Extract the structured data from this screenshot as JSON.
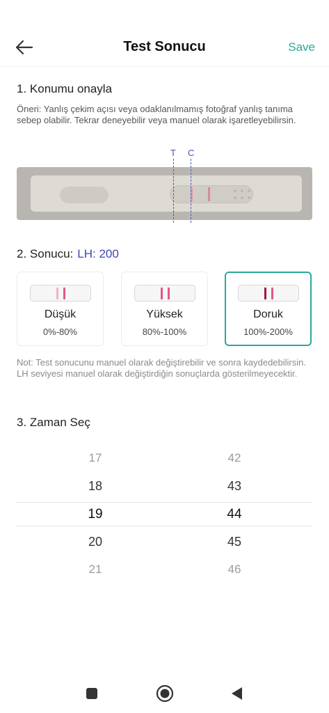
{
  "header": {
    "title": "Test Sonucu",
    "save_label": "Save",
    "back_icon": "arrow-left-icon"
  },
  "section1": {
    "title": "1. Konumu onayla",
    "description": "Öneri: Yanlış çekim açısı veya odaklanılmamış fotoğraf yanlış tanıma sebep olabilir. Tekrar deneyebilir veya manuel olarak işaretleyebilirsin.",
    "marker_t": "T",
    "marker_c": "C"
  },
  "section2": {
    "title": "2. Sonucu:",
    "lh_value": "LH: 200",
    "cards": [
      {
        "label": "Düşük",
        "range": "0%-80%",
        "selected": false
      },
      {
        "label": "Yüksek",
        "range": "80%-100%",
        "selected": false
      },
      {
        "label": "Doruk",
        "range": "100%-200%",
        "selected": true
      }
    ],
    "note": "Not: Test sonucunu manuel olarak değiştirebilir ve sonra kaydedebilirsin. LH seviyesi manuel olarak değiştirdiğin sonuçlarda gösterilmeyecektir."
  },
  "section3": {
    "title": "3. Zaman Seç",
    "hours": [
      "17",
      "18",
      "19",
      "20",
      "21"
    ],
    "minutes": [
      "42",
      "43",
      "44",
      "45",
      "46"
    ],
    "selected_hour": "19",
    "selected_minute": "44"
  },
  "colors": {
    "accent": "#2aa89a",
    "lh": "#3b46b0",
    "marker": "#4a55b8",
    "line_low": "#e08aa6",
    "line_high": "#d4507a",
    "line_peak": "#a01448"
  },
  "navbar": {
    "icons": [
      "square-icon",
      "home-circle-icon",
      "back-triangle-icon"
    ]
  }
}
